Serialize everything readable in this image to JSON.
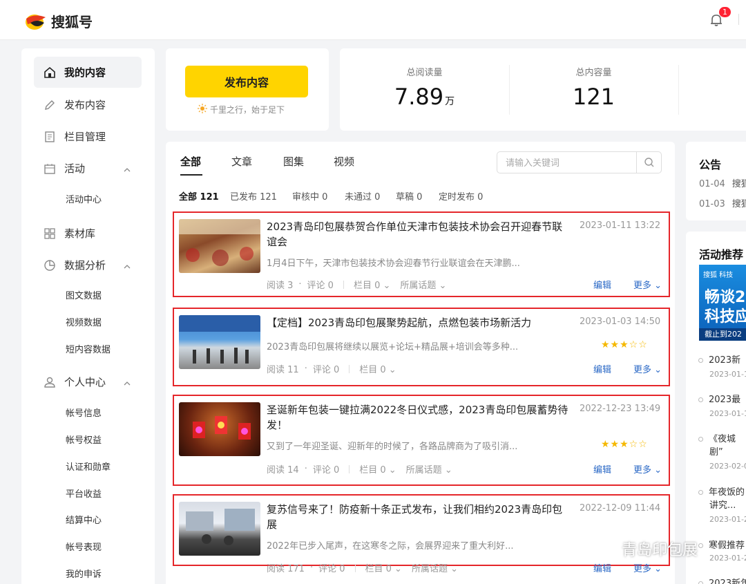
{
  "header": {
    "brand": "搜狐号",
    "notification_count": "1"
  },
  "sidebar": {
    "items": [
      {
        "label": "我的内容",
        "icon": "home-icon"
      },
      {
        "label": "发布内容",
        "icon": "pen-icon"
      },
      {
        "label": "栏目管理",
        "icon": "document-icon"
      },
      {
        "label": "活动",
        "icon": "calendar-icon"
      },
      {
        "label": "素材库",
        "icon": "grid-icon"
      },
      {
        "label": "数据分析",
        "icon": "pie-chart-icon"
      },
      {
        "label": "个人中心",
        "icon": "user-icon"
      }
    ],
    "activity_sub": [
      "活动中心"
    ],
    "data_sub": [
      "图文数据",
      "视频数据",
      "短内容数据"
    ],
    "personal_sub": [
      "帐号信息",
      "帐号权益",
      "认证和勋章",
      "平台收益",
      "结算中心",
      "帐号表现",
      "我的申诉"
    ]
  },
  "publish": {
    "button_label": "发布内容",
    "slogan": "千里之行，始于足下"
  },
  "stats": {
    "reads_label": "总阅读量",
    "reads_value": "7.89",
    "reads_unit": "万",
    "content_label": "总内容量",
    "content_value": "121"
  },
  "content": {
    "tabs": [
      "全部",
      "文章",
      "图集",
      "视频"
    ],
    "search_placeholder": "请输入关键词",
    "filters": [
      "全部 121",
      "已发布 121",
      "审核中 0",
      "未通过 0",
      "草稿 0",
      "定时发布 0"
    ],
    "edit_label": "编辑",
    "more_label": "更多",
    "articles": [
      {
        "title": "2023青岛印包展恭贺合作单位天津市包装技术协会召开迎春节联谊会",
        "date": "2023-01-11 13:22",
        "summary": "1月4日下午，天津市包装技术协会迎春节行业联谊会在天津鹏...",
        "reads": "阅读 3",
        "comments": "评论 0",
        "column": "栏目 0",
        "topic": "所属话题"
      },
      {
        "title": "【定档】2023青岛印包展聚势起航，点燃包装市场新活力",
        "date": "2023-01-03 14:50",
        "summary": "2023青岛印包展将继续以展览+论坛+精品展+培训会等多种...",
        "reads": "阅读 11",
        "comments": "评论 0",
        "column": "栏目 0",
        "rating": 3
      },
      {
        "title": "圣诞新年包装一键拉满2022冬日仪式感，2023青岛印包展蓄势待发！",
        "date": "2022-12-23 13:49",
        "summary": "又到了一年迎圣诞、迎新年的时候了，各路品牌商为了吸引消...",
        "reads": "阅读 14",
        "comments": "评论 0",
        "column": "栏目 0",
        "topic": "所属话题",
        "rating": 3
      },
      {
        "title": "复苏信号来了！防疫新十条正式发布，让我们相约2023青岛印包展",
        "date": "2022-12-09 11:44",
        "summary": "2022年已步入尾声，在这寒冬之际，会展界迎来了重大利好...",
        "reads": "阅读 171",
        "comments": "评论 0",
        "column": "栏目 0",
        "topic": "所属话题"
      }
    ]
  },
  "notice": {
    "title": "公告",
    "rows": [
      {
        "date": "01-04",
        "text": "搜狐"
      },
      {
        "date": "01-03",
        "text": "搜狐"
      }
    ]
  },
  "activity": {
    "title": "活动推荐",
    "banner_tag": "搜狐 科技",
    "banner_line1": "畅谈2",
    "banner_line2": "科技应",
    "banner_foot": "截止到202",
    "items": [
      {
        "text": "2023新",
        "date": "2023-01-1"
      },
      {
        "text": "2023最",
        "date": "2023-01-1"
      },
      {
        "text": "《夜城",
        "text2": "剧”",
        "date": "2023-02-0"
      },
      {
        "text": "年夜饭的",
        "text2": "讲究...",
        "date": "2023-01-2"
      },
      {
        "text": "寒假推荐",
        "date": "2023-01-2"
      },
      {
        "text": "2023新年",
        "date": ""
      }
    ]
  },
  "watermark": {
    "text": "青岛印包展"
  },
  "colors": {
    "accent": "#ffd400",
    "link": "#2b69c6",
    "highlight_border": "#e5262a",
    "star": "#f5b800"
  }
}
